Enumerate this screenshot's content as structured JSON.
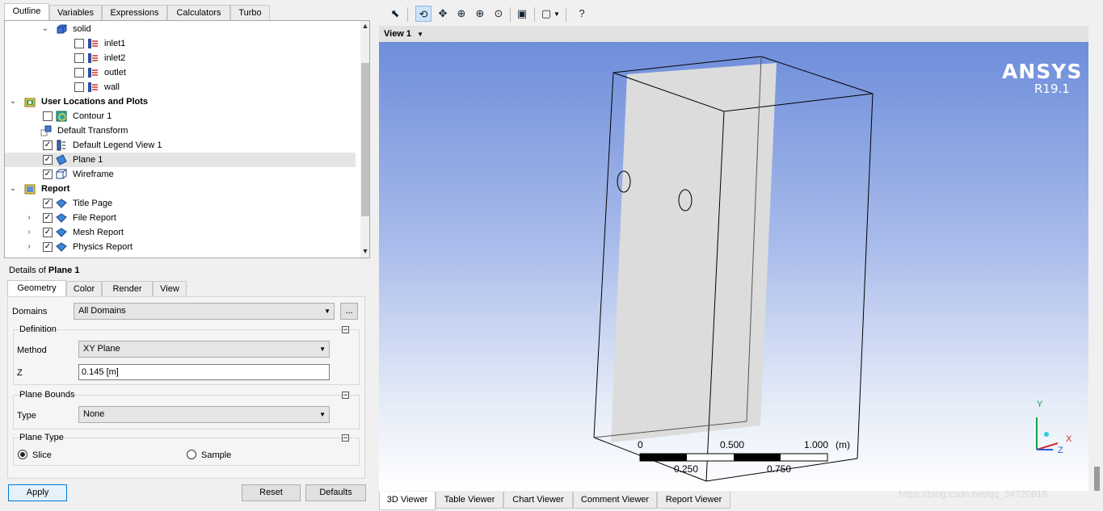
{
  "outline_tabs": [
    "Outline",
    "Variables",
    "Expressions",
    "Calculators",
    "Turbo"
  ],
  "tree": {
    "solid": "solid",
    "inlet1": "inlet1",
    "inlet2": "inlet2",
    "outlet": "outlet",
    "wall": "wall",
    "user_locations": "User Locations and Plots",
    "contour1": "Contour 1",
    "default_transform": "Default Transform",
    "default_legend": "Default Legend View 1",
    "plane1": "Plane 1",
    "wireframe": "Wireframe",
    "report": "Report",
    "title_page": "Title Page",
    "file_report": "File Report",
    "mesh_report": "Mesh Report",
    "physics_report": "Physics Report"
  },
  "details": {
    "prefix": "Details of ",
    "object": "Plane 1",
    "tabs": [
      "Geometry",
      "Color",
      "Render",
      "View"
    ],
    "domains_label": "Domains",
    "domains_value": "All Domains",
    "more_button": "...",
    "definition_title": "Definition",
    "method_label": "Method",
    "method_value": "XY Plane",
    "z_label": "Z",
    "z_value": "0.145 [m]",
    "bounds_title": "Plane Bounds",
    "type_label": "Type",
    "type_value": "None",
    "plane_type_title": "Plane Type",
    "slice_label": "Slice",
    "sample_label": "Sample",
    "apply": "Apply",
    "reset": "Reset",
    "defaults": "Defaults"
  },
  "viewer": {
    "view_label": "View 1",
    "brand": "ANSYS",
    "version": "R19.1",
    "scale_0": "0",
    "scale_0500": "0.500",
    "scale_1000": "1.000",
    "scale_unit": "(m)",
    "scale_0250": "0.250",
    "scale_0750": "0.750",
    "axis_x": "X",
    "axis_y": "Y",
    "axis_z": "Z",
    "tabs": [
      "3D Viewer",
      "Table Viewer",
      "Chart Viewer",
      "Comment Viewer",
      "Report Viewer"
    ]
  },
  "watermark": "https://blog.csdn.net/qq_34720818"
}
